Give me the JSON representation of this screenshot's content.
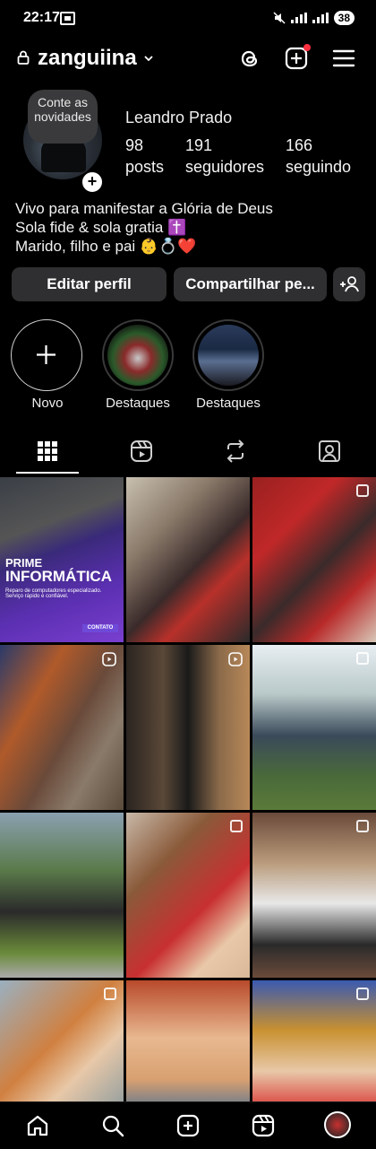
{
  "status": {
    "time": "22:17",
    "battery": "38"
  },
  "header": {
    "username": "zanguiina"
  },
  "profile": {
    "note": "Conte as novidades",
    "full_name": "Leandro Prado",
    "stats": [
      {
        "value": "98",
        "label": "posts"
      },
      {
        "value": "191",
        "label": "seguidores"
      },
      {
        "value": "166",
        "label": "seguindo"
      }
    ],
    "bio": [
      "Vivo para manifestar a Glória de Deus",
      "Sola fide & sola gratia ✝️",
      "Marido, filho e pai 👶💍❤️"
    ]
  },
  "buttons": {
    "edit": "Editar perfil",
    "share": "Compartilhar pe..."
  },
  "highlights": [
    {
      "label": "Novo"
    },
    {
      "label": "Destaques"
    },
    {
      "label": "Destaques"
    }
  ],
  "tabs": [
    "grid-icon",
    "reels-icon",
    "repost-icon",
    "tagged-icon"
  ],
  "promo": {
    "title1": "PRIME",
    "title2": "INFORMÁTICA",
    "tagline": "Reparo de computadores especializado. Serviço rápido e confiável.",
    "contact": "CONTATO"
  },
  "colors": {
    "accent": "#ff3040",
    "button_bg": "#2f2f31",
    "background": "#000000"
  }
}
